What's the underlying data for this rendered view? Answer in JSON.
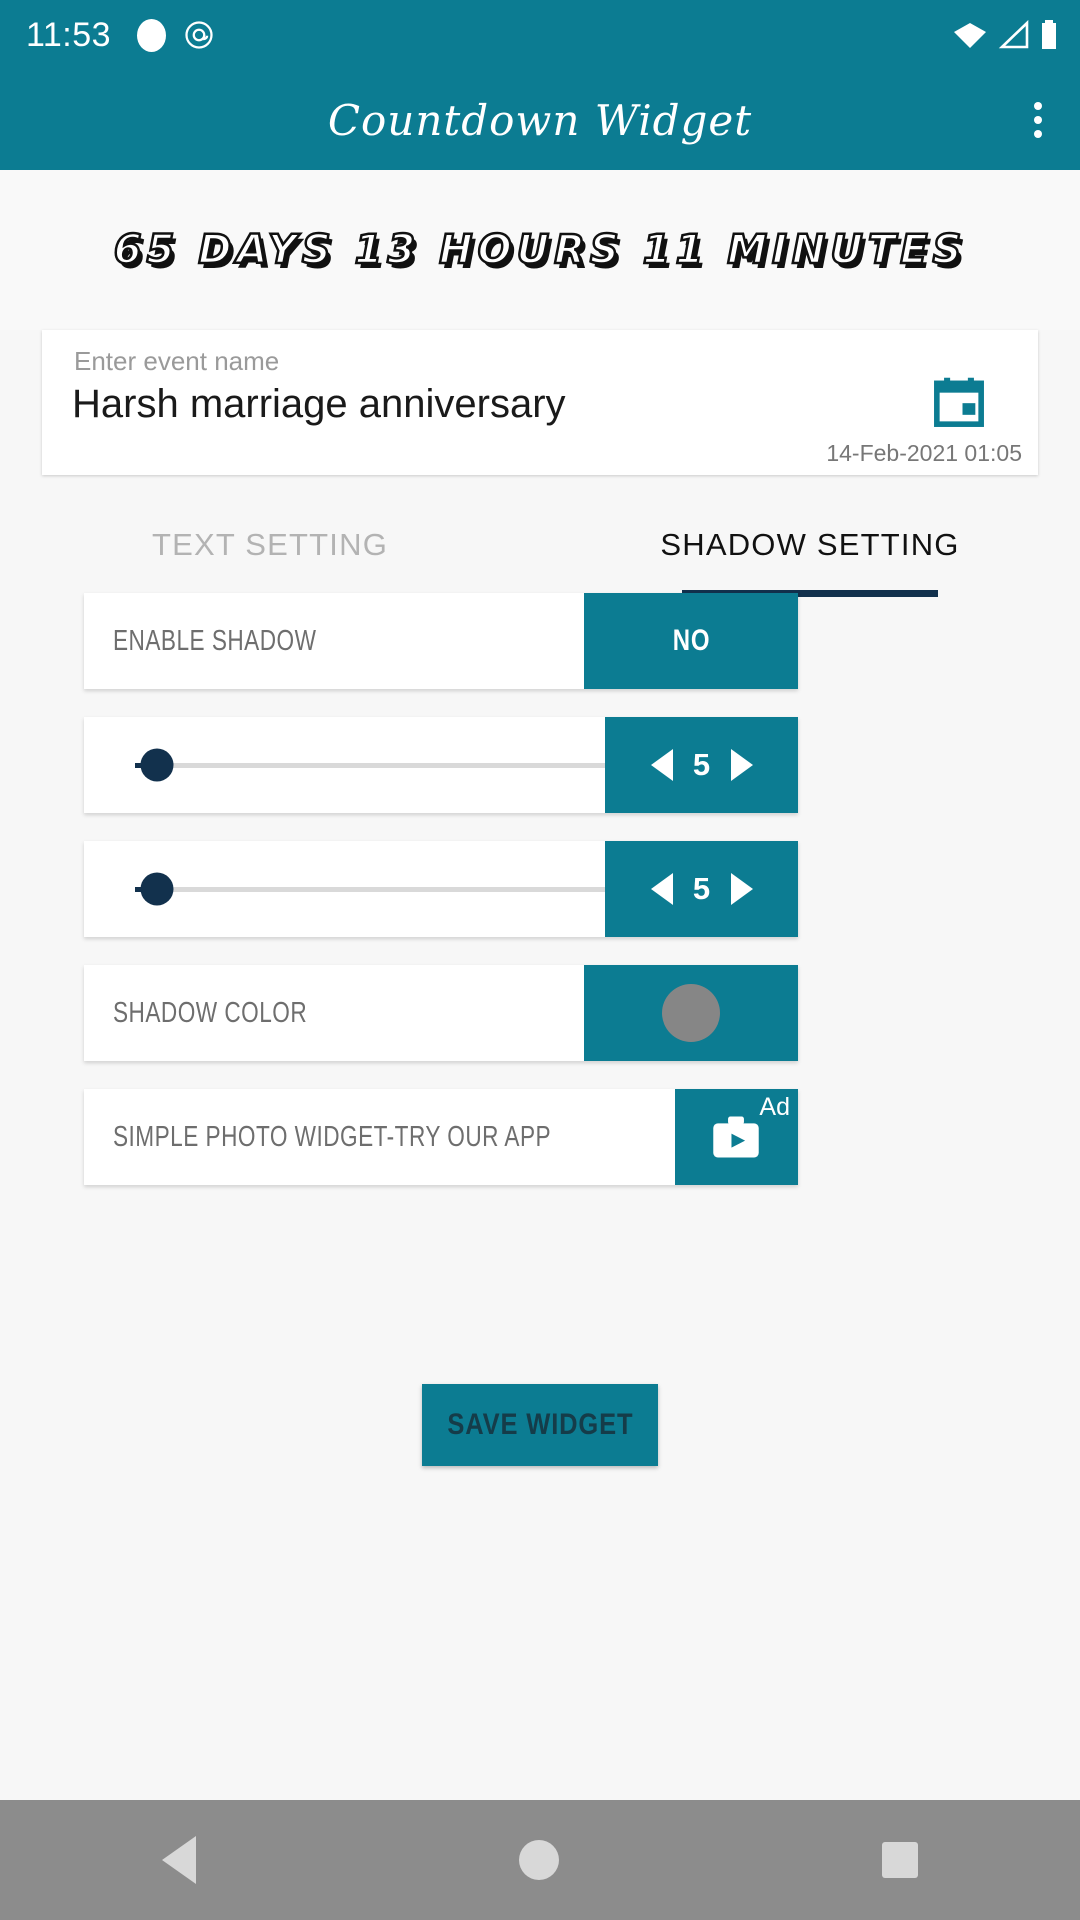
{
  "status_bar": {
    "time": "11:53",
    "icons": [
      "circle-icon",
      "at-icon",
      "wifi-icon",
      "signal-icon",
      "battery-icon"
    ]
  },
  "app_bar": {
    "title": "Countdown Widget",
    "menu_icon": "overflow-menu-icon"
  },
  "preview": {
    "countdown_text": "65 DAYS 13 HOURS 11 MINUTES"
  },
  "event_card": {
    "label": "Enter event name",
    "value": "Harsh marriage anniversary",
    "placeholder": "Enter event name",
    "date": "14-Feb-2021 01:05",
    "calendar_icon": "calendar-icon"
  },
  "tabs": [
    {
      "label": "TEXT SETTING",
      "active": false
    },
    {
      "label": "SHADOW SETTING",
      "active": true
    }
  ],
  "settings": [
    {
      "label": "ENABLE SHADOW",
      "control": "toggle",
      "value": "NO"
    },
    {
      "label": "",
      "control": "slider",
      "value": "5"
    },
    {
      "label": "",
      "control": "slider",
      "value": "5"
    },
    {
      "label": "SHADOW COLOR",
      "control": "color",
      "value": "#868686"
    },
    {
      "label": "SIMPLE PHOTO WIDGET-TRY OUR APP",
      "control": "ad",
      "value": "Ad"
    }
  ],
  "save_button": {
    "label": "SAVE WIDGET"
  },
  "nav_bar": {
    "back": "back-icon",
    "home": "home-icon",
    "recents": "recents-icon"
  },
  "colors": {
    "primary": "#0c7c92",
    "accent_dark": "#12314d",
    "background": "#f7f7f7"
  }
}
